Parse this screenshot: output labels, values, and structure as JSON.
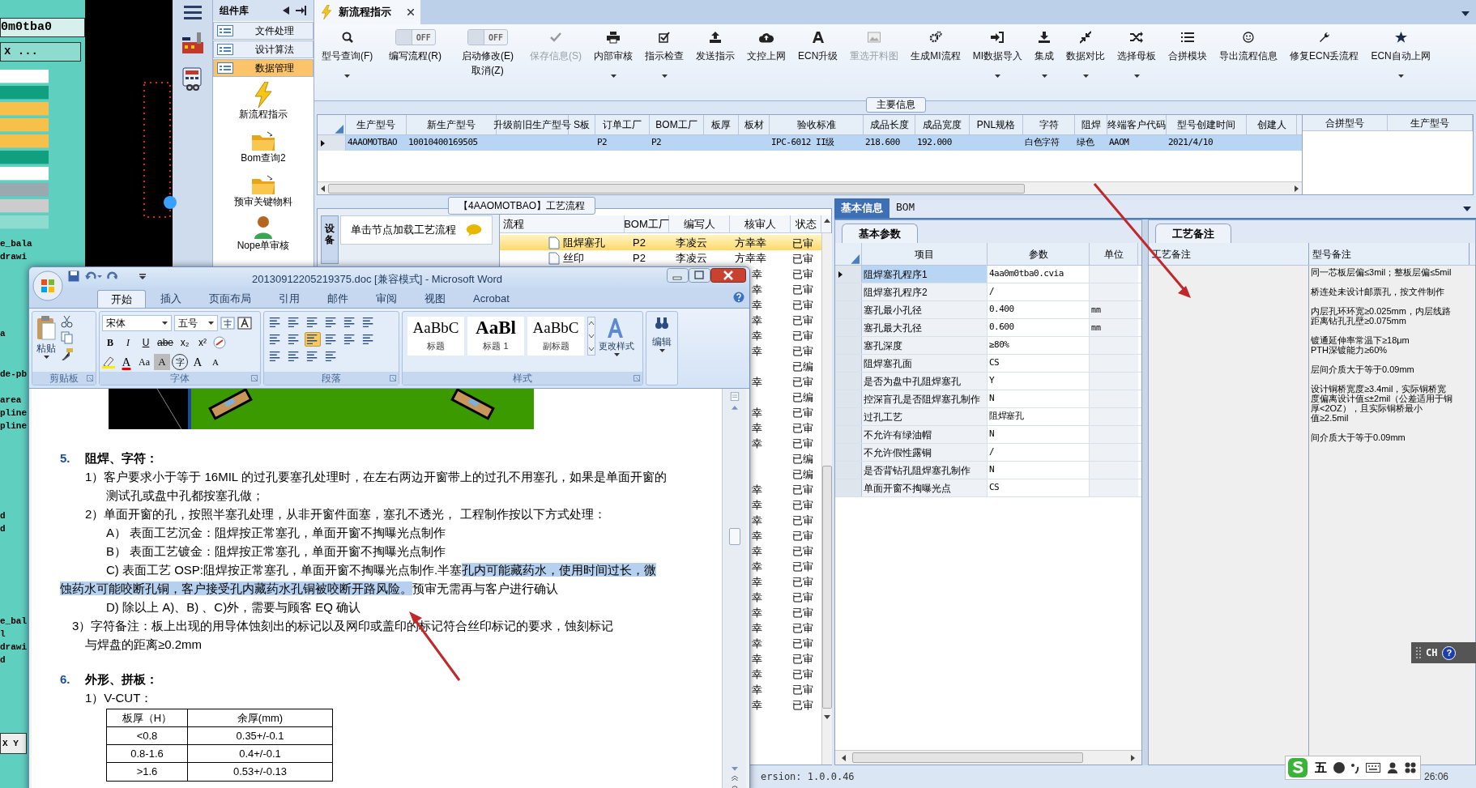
{
  "cad": {
    "field_1": "0m0tba0",
    "field_2": "x ...",
    "labels": [
      "e_bala",
      "drawi",
      "a",
      "de-pb",
      "area",
      "pline",
      "pline",
      "d",
      "d",
      "e_bal",
      "l",
      "drawi",
      "d"
    ],
    "coords": "X Y"
  },
  "component_library": {
    "title": "组件库",
    "categories": [
      {
        "label": "文件处理",
        "selected": false
      },
      {
        "label": "设计算法",
        "selected": false
      },
      {
        "label": "数据管理",
        "selected": true
      }
    ],
    "items": [
      {
        "label": "新流程指示",
        "kind": "lightning"
      },
      {
        "label": "Bom查询2",
        "kind": "folder"
      },
      {
        "label": "预审关键物料",
        "kind": "folder"
      },
      {
        "label": "Nope单审核",
        "kind": "person"
      }
    ]
  },
  "tabs": [
    {
      "label": "新流程指示",
      "selected": true
    }
  ],
  "toolbar": [
    {
      "kind": "button",
      "label": "型号查询(F)",
      "dropdown": true,
      "disabled": false
    },
    {
      "kind": "toggle",
      "state_text": "OFF",
      "on": false,
      "label": "编写流程(R)"
    },
    {
      "kind": "toggle",
      "state_text": "OFF",
      "on": false,
      "label": "启动修改(E)",
      "label_2": "取消(Z)"
    },
    {
      "kind": "button",
      "label": "保存信息(S)",
      "dropdown": false,
      "disabled": true
    },
    {
      "kind": "button",
      "label": "内部审核",
      "dropdown": true,
      "disabled": false
    },
    {
      "kind": "button",
      "label": "指示检查",
      "dropdown": true,
      "disabled": false
    },
    {
      "kind": "button",
      "label": "发送指示",
      "dropdown": false,
      "disabled": false
    },
    {
      "kind": "button",
      "label": "文控上网",
      "dropdown": false,
      "disabled": false
    },
    {
      "kind": "button",
      "label": "ECN升级",
      "dropdown": false,
      "disabled": false
    },
    {
      "kind": "button",
      "label": "重选开料图",
      "dropdown": false,
      "disabled": true
    },
    {
      "kind": "button",
      "label": "生成MI流程",
      "dropdown": false,
      "disabled": false
    },
    {
      "kind": "button",
      "label": "MI数据导入",
      "dropdown": true,
      "disabled": false
    },
    {
      "kind": "button",
      "label": "集成",
      "dropdown": true,
      "disabled": false
    },
    {
      "kind": "button",
      "label": "数据对比",
      "dropdown": true,
      "disabled": false
    },
    {
      "kind": "button",
      "label": "选择母板",
      "dropdown": true,
      "disabled": false
    },
    {
      "kind": "button",
      "label": "合拼模块",
      "dropdown": false,
      "disabled": false
    },
    {
      "kind": "button",
      "label": "导出流程信息",
      "dropdown": false,
      "disabled": false
    },
    {
      "kind": "button",
      "label": "修复ECN丢流程",
      "dropdown": false,
      "disabled": false
    },
    {
      "kind": "button",
      "label": "ECN自动上网",
      "dropdown": true,
      "disabled": false
    }
  ],
  "main_info": {
    "title": "主要信息",
    "columns": [
      "生产型号",
      "新生产型号",
      "升级前旧生产型号",
      "S板",
      "订单工厂",
      "BOM工厂",
      "板厚",
      "板材",
      "验收标准",
      "成品长度",
      "成品宽度",
      "PNL规格",
      "字符",
      "阻焊",
      "终端客户代码",
      "型号创建时间",
      "创建人"
    ],
    "rows": [
      {
        "selected": true,
        "cells": [
          "4AAOMOTBAO",
          "10010400169505",
          "",
          "",
          "P2",
          "P2",
          "",
          "",
          "IPC-6012 II级",
          "218.600",
          "192.000",
          "",
          "白色字符",
          "绿色",
          "AAOM",
          "2021/4/10",
          ""
        ]
      }
    ],
    "side_columns": [
      "合拼型号",
      "生产型号"
    ]
  },
  "process": {
    "title": "【4AAOMOTBAO】工艺流程",
    "side_tab": "设备",
    "hint": "单击节点加载工艺流程",
    "columns": [
      "流程",
      "BOM工厂",
      "编写人",
      "核审人",
      "状态"
    ],
    "rows": [
      {
        "name": "阻焊塞孔",
        "bom": "P2",
        "author": "李凌云",
        "reviewer": "方幸幸",
        "status": "已审",
        "selected": true
      },
      {
        "name": "丝印",
        "bom": "P2",
        "author": "李凌云",
        "reviewer": "方幸幸",
        "status": "已审",
        "selected": false
      },
      {
        "reviewer": "幸",
        "status": "已审",
        "selected": false
      },
      {
        "reviewer": "幸",
        "status": "已审",
        "selected": false
      },
      {
        "reviewer": "幸",
        "status": "已审",
        "selected": false
      },
      {
        "reviewer": "幸",
        "status": "已审",
        "selected": false
      },
      {
        "reviewer": "幸",
        "status": "已审",
        "selected": false
      },
      {
        "reviewer": "幸",
        "status": "已审",
        "selected": false
      },
      {
        "status": "已编",
        "selected": false
      },
      {
        "reviewer": "幸",
        "status": "已审",
        "selected": false
      },
      {
        "status": "已编",
        "selected": false
      },
      {
        "reviewer": "幸",
        "status": "已审",
        "selected": false
      },
      {
        "reviewer": "幸",
        "status": "已审",
        "selected": false
      },
      {
        "reviewer": "幸",
        "status": "已审",
        "selected": false
      },
      {
        "status": "已编",
        "selected": false
      },
      {
        "status": "已编",
        "selected": false
      },
      {
        "reviewer": "幸",
        "status": "已审",
        "selected": false
      },
      {
        "reviewer": "幸",
        "status": "已审",
        "selected": false
      },
      {
        "reviewer": "幸",
        "status": "已审",
        "selected": false
      },
      {
        "reviewer": "幸",
        "status": "已审",
        "selected": false
      },
      {
        "reviewer": "幸",
        "status": "已审",
        "selected": false
      },
      {
        "reviewer": "幸",
        "status": "已审",
        "selected": false
      },
      {
        "reviewer": "幸",
        "status": "已审",
        "selected": false
      },
      {
        "reviewer": "幸",
        "status": "已审",
        "selected": false
      },
      {
        "reviewer": "幸",
        "status": "已审",
        "selected": false
      },
      {
        "reviewer": "幸",
        "status": "已审",
        "selected": false
      },
      {
        "reviewer": "幸",
        "status": "已审",
        "selected": false
      },
      {
        "reviewer": "幸",
        "status": "已审",
        "selected": false
      },
      {
        "reviewer": "幸",
        "status": "已审",
        "selected": false
      },
      {
        "reviewer": "幸",
        "status": "已审",
        "selected": false
      },
      {
        "reviewer": "幸",
        "status": "已审",
        "selected": false
      }
    ]
  },
  "detail_tabs": [
    {
      "label": "基本信息",
      "selected": true
    },
    {
      "label": "BOM",
      "selected": false
    }
  ],
  "basic_params": {
    "tab": "基本参数",
    "columns": [
      "项目",
      "参数",
      "单位"
    ],
    "rows": [
      {
        "item": "阻焊塞孔程序1",
        "value": "4aa0m0tba0.cvia",
        "unit": "",
        "selected": true
      },
      {
        "item": "阻焊塞孔程序2",
        "value": "/",
        "unit": "",
        "selected": false
      },
      {
        "item": "塞孔最小孔径",
        "value": "0.400",
        "unit": "mm",
        "selected": false
      },
      {
        "item": "塞孔最大孔径",
        "value": "0.600",
        "unit": "mm",
        "selected": false
      },
      {
        "item": "塞孔深度",
        "value": "≥80%",
        "unit": "",
        "selected": false
      },
      {
        "item": "阻焊塞孔面",
        "value": "CS",
        "unit": "",
        "selected": false
      },
      {
        "item": "是否为盘中孔阻焊塞孔",
        "value": "Y",
        "unit": "",
        "selected": false
      },
      {
        "item": "控深盲孔是否阻焊塞孔制作",
        "value": "N",
        "unit": "",
        "selected": false
      },
      {
        "item": "过孔工艺",
        "value": "阻焊塞孔",
        "unit": "",
        "selected": false
      },
      {
        "item": "不允许有绿油帽",
        "value": "N",
        "unit": "",
        "selected": false
      },
      {
        "item": "不允许假性露铜",
        "value": "/",
        "unit": "",
        "selected": false
      },
      {
        "item": "是否背钻孔阻焊塞孔制作",
        "value": "N",
        "unit": "",
        "selected": false
      },
      {
        "item": "单面开窗不掏曝光点",
        "value": "CS",
        "unit": "",
        "selected": false
      }
    ]
  },
  "process_notes": {
    "tab": "工艺备注",
    "columns": [
      "工艺备注",
      "型号备注"
    ],
    "model_notes": [
      [
        "同一芯板层偏≤3mil；整板层偏≤5mil"
      ],
      [
        "桥连处未设计邮票孔，按文件制作"
      ],
      [
        "内层孔环环宽≥0.025mm，内层线路距离钻孔孔壁≥0.075mm"
      ],
      [
        "镀通延伸率常温下≥18μm",
        "PTH深镀能力≥60%"
      ],
      [
        "层间介质大于等于0.09mm"
      ],
      [
        "设计铜桥宽度≥3.4mil，实际铜桥宽度偏离设计值≤±2mil（公差适用于铜厚<2OZ），且实际铜桥最小",
        "值≥2.5mil"
      ],
      [
        "间介质大于等于0.09mm"
      ]
    ]
  },
  "status_bar": {
    "version": "ersion: 1.0.0.46",
    "time": "26:06"
  },
  "ime_bar": {
    "mode": "五"
  },
  "language_bar": {
    "label": "CH",
    "help": "?"
  },
  "word": {
    "title": "20130912205219375.doc [兼容模式] - Microsoft Word",
    "tabs": [
      {
        "label": "开始",
        "selected": true
      },
      {
        "label": "插入",
        "selected": false
      },
      {
        "label": "页面布局",
        "selected": false
      },
      {
        "label": "引用",
        "selected": false
      },
      {
        "label": "邮件",
        "selected": false
      },
      {
        "label": "审阅",
        "selected": false
      },
      {
        "label": "视图",
        "selected": false
      },
      {
        "label": "Acrobat",
        "selected": false
      }
    ],
    "clipboard": {
      "paste": "粘贴",
      "group": "剪贴板"
    },
    "font": {
      "name": "宋体",
      "size": "五号",
      "row_1": [
        "B",
        "I",
        "U",
        "abe",
        "x₂",
        "x²"
      ],
      "row_2": [
        "A",
        "Aa",
        "A",
        "字",
        "A",
        "A"
      ],
      "group": "字体"
    },
    "paragraph": {
      "group": "段落",
      "buttons": [
        {
          "selected": false
        },
        {
          "selected": false
        },
        {
          "selected": false
        },
        {
          "selected": false
        },
        {
          "selected": false
        },
        {
          "selected": false
        },
        {
          "selected": false
        },
        {
          "selected": false
        },
        {
          "selected": true
        },
        {
          "selected": false
        },
        {
          "selected": false
        },
        {
          "selected": false
        },
        {
          "selected": false
        },
        {
          "selected": false
        },
        {
          "selected": false
        },
        {
          "selected": false
        }
      ]
    },
    "styles": {
      "group": "样式",
      "gallery": [
        {
          "preview": "AaBbC",
          "name": "标题"
        },
        {
          "preview": "AaBl",
          "name": "标题 1"
        },
        {
          "preview": "AaBbC",
          "name": "副标题"
        }
      ],
      "change": "更改样式"
    },
    "editing": "编辑",
    "blocks": [
      {
        "kind": "picture"
      },
      {
        "kind": "heading",
        "number": "5.",
        "text": "阻焊、字符："
      },
      {
        "kind": "item",
        "segments": [
          {
            "text": "1）客户要求小于等于 16MIL 的过孔要塞孔处理时，在左右两边开窗带上的过孔不用塞孔，如果是单面开窗的",
            "highlighted": false
          }
        ]
      },
      {
        "kind": "item_continued",
        "segments": [
          {
            "text": "测试孔或盘中孔都按塞孔做；",
            "highlighted": false
          }
        ]
      },
      {
        "kind": "item",
        "segments": [
          {
            "text": "2）单面开窗的孔，按照半塞孔处理，从非开窗件面塞，塞孔不透光， 工程制作按以下方式处理：",
            "highlighted": false
          }
        ]
      },
      {
        "kind": "sub_item",
        "segments": [
          {
            "text": "A）  表面工艺沉金：阻焊按正常塞孔，单面开窗不掏曝光点制作",
            "highlighted": false
          }
        ]
      },
      {
        "kind": "sub_item",
        "segments": [
          {
            "text": "B）  表面工艺镀金：阻焊按正常塞孔，单面开窗不掏曝光点制作",
            "highlighted": false
          }
        ]
      },
      {
        "kind": "sub_item",
        "segments": [
          {
            "text": " C)   表面工艺 OSP:阻焊按正常塞孔，单面开窗不掏曝光点制作.半塞",
            "highlighted": false
          },
          {
            "text": "孔内可能藏药水，使用时间过长，微",
            "highlighted": true
          }
        ]
      },
      {
        "kind": "flush",
        "segments": [
          {
            "text": "蚀药水可能咬断孔铜，客户接受孔内藏药水孔铜被咬断开路风险。",
            "highlighted": true
          },
          {
            "text": "预审无需再与客户进行确认",
            "highlighted": false
          }
        ]
      },
      {
        "kind": "sub_item",
        "segments": [
          {
            "text": " D) 除以上 A)、B) 、C)外，需要与顾客 EQ 确认",
            "highlighted": false
          }
        ]
      },
      {
        "kind": "note",
        "segments": [
          {
            "text": "3）字符备注：板上出现的用导体蚀刻出的标记以及网印或盖印的标记符合丝印标记的要求，蚀刻标记",
            "highlighted": false
          }
        ]
      },
      {
        "kind": "item",
        "segments": [
          {
            "text": "与焊盘的距离≥0.2mm",
            "highlighted": false
          }
        ]
      },
      {
        "kind": "blank"
      },
      {
        "kind": "heading",
        "number": "6.",
        "text": "外形、拼板："
      },
      {
        "kind": "item",
        "segments": [
          {
            "text": "1）V-CUT：",
            "highlighted": false
          }
        ]
      },
      {
        "kind": "table",
        "header": [
          "板厚（H）",
          "余厚(mm)"
        ],
        "rows": [
          [
            "<0.8",
            "0.35+/-0.1"
          ],
          [
            "0.8-1.6",
            "0.4+/-0.1"
          ],
          [
            ">1.6",
            "0.53+/-0.13"
          ]
        ]
      }
    ]
  }
}
